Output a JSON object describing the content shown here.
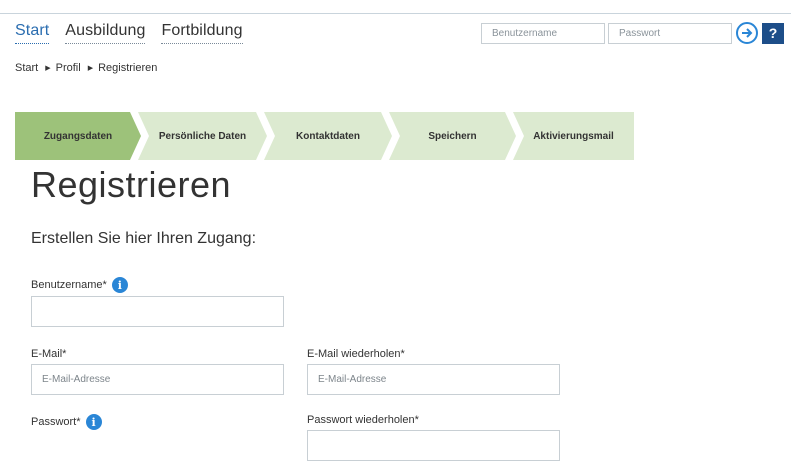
{
  "nav": {
    "start": "Start",
    "ausbildung": "Ausbildung",
    "fortbildung": "Fortbildung"
  },
  "login": {
    "username_placeholder": "Benutzername",
    "password_placeholder": "Passwort",
    "help": "?"
  },
  "breadcrumb": [
    "Start",
    "Profil",
    "Registrieren"
  ],
  "steps": [
    "Zugangsdaten",
    "Persönliche Daten",
    "Kontaktdaten",
    "Speichern",
    "Aktivierungsmail"
  ],
  "active_step": "Zugangsdaten",
  "page": {
    "title": "Registrieren",
    "subtitle": "Erstellen Sie hier Ihren Zugang:"
  },
  "form": {
    "username_label": "Benutzername*",
    "email_label": "E-Mail*",
    "email_placeholder": "E-Mail-Adresse",
    "email_repeat_label": "E-Mail wiederholen*",
    "email_repeat_placeholder": "E-Mail-Adresse",
    "password_label": "Passwort*",
    "password_repeat_label": "Passwort wiederholen*"
  },
  "colors": {
    "accent": "#2a6db0",
    "step_active": "#9dc27a",
    "step_inactive": "#dcead0",
    "help_bg": "#1d4e89"
  }
}
